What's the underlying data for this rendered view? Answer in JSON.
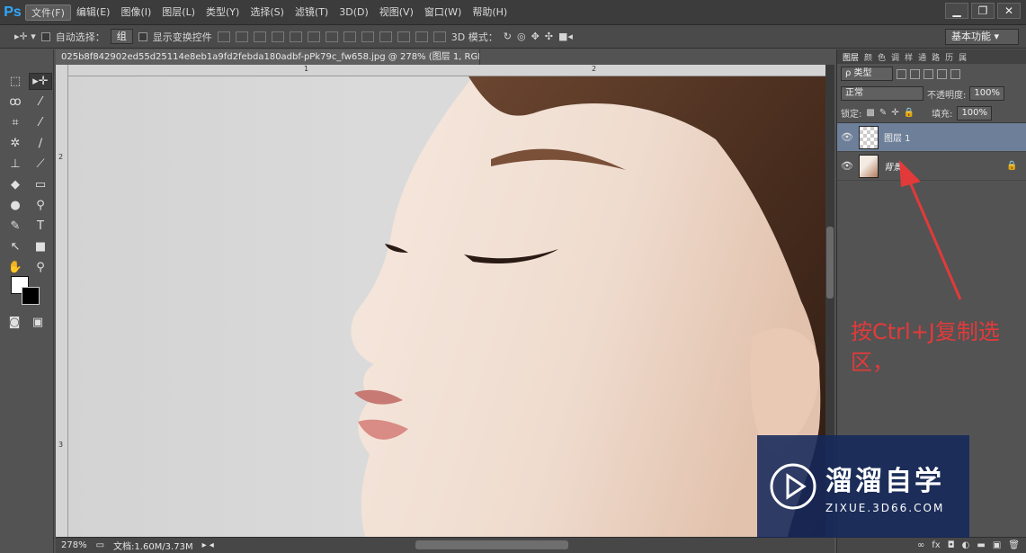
{
  "app": {
    "logo": "Ps"
  },
  "menu": [
    "文件(F)",
    "编辑(E)",
    "图像(I)",
    "图层(L)",
    "类型(Y)",
    "选择(S)",
    "滤镜(T)",
    "3D(D)",
    "视图(V)",
    "窗口(W)",
    "帮助(H)"
  ],
  "window_controls": {
    "minimize": "▁",
    "restore": "❐",
    "close": "✕"
  },
  "options": {
    "auto_select_label": "自动选择：",
    "auto_select_value": "组",
    "show_transform_label": "显示变换控件",
    "mode_3d_label": "3D 模式：",
    "workspace": "基本功能"
  },
  "document": {
    "tab_title": "025b8f842902ed55d25114e8eb1a9fd2febda180adbf-pPk79c_fw658.jpg @ 278% (图层 1, RGB/8) *",
    "ruler_top_marks": [
      "1",
      "2"
    ],
    "ruler_left_marks": [
      "2",
      "3"
    ],
    "zoom": "278%",
    "doc_size": "文档:1.60M/3.73M"
  },
  "layers_panel": {
    "tabs": [
      "图层",
      "颜",
      "色",
      "调",
      "样",
      "通",
      "路",
      "历",
      "属"
    ],
    "filter_label": "ρ 类型",
    "blend_mode": "正常",
    "opacity_label": "不透明度:",
    "opacity_value": "100%",
    "lock_label": "锁定:",
    "fill_label": "填充:",
    "fill_value": "100%",
    "layers": [
      {
        "name": "图层 1",
        "selected": true,
        "locked": false
      },
      {
        "name": "背景",
        "selected": false,
        "locked": true
      }
    ],
    "bottom_icons": [
      "∞",
      "fx",
      "◘",
      "◐",
      "▬",
      "▣",
      "🗑"
    ]
  },
  "annotation": {
    "text": "按Ctrl+J复制选区，",
    "color": "#e23a3a"
  },
  "watermark": {
    "title": "溜溜自学",
    "url": "ZIXUE.3D66.COM"
  }
}
